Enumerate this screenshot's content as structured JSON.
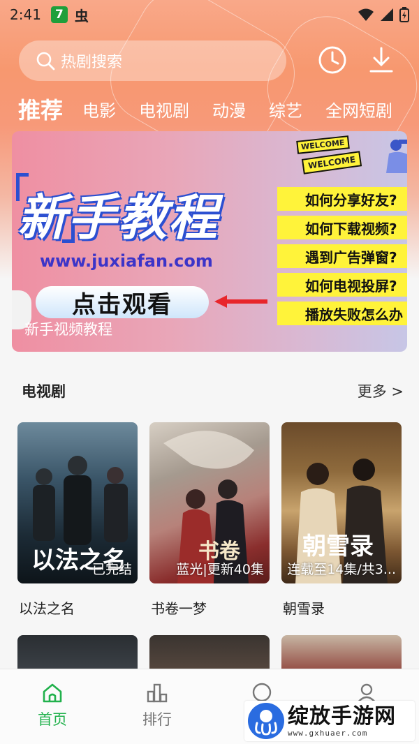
{
  "status_bar": {
    "time": "2:41",
    "app_badge": "7",
    "bug_glyph": "虫",
    "icons": [
      "wifi-icon",
      "signal-icon",
      "battery-icon"
    ]
  },
  "search": {
    "placeholder": "热剧搜索",
    "history_icon": "clock-icon",
    "download_icon": "download-icon"
  },
  "tabs": [
    {
      "label": "推荐",
      "active": true
    },
    {
      "label": "电影"
    },
    {
      "label": "电视剧"
    },
    {
      "label": "动漫"
    },
    {
      "label": "综艺"
    },
    {
      "label": "全网短剧"
    }
  ],
  "banner": {
    "title": "新手教程",
    "url": "www.juxiafan.com",
    "cta": "点击观看",
    "caption": "新手视频教程",
    "welcome_1": "WELCOME",
    "welcome_2": "WELCOME",
    "faq": [
      "如何分享好友?",
      "如何下载视频?",
      "遇到广告弹窗?",
      "如何电视投屏?",
      "播放失败怎么办"
    ]
  },
  "section": {
    "title": "电视剧",
    "more": "更多 >"
  },
  "shows": [
    {
      "name": "以法之名",
      "badge": "已完结",
      "poster_text": "以法之名"
    },
    {
      "name": "书卷一梦",
      "badge": "蓝光|更新40集",
      "poster_text": "书卷"
    },
    {
      "name": "朝雪录",
      "badge": "连载至14集/共3...",
      "poster_text": "朝雪录"
    }
  ],
  "nav": [
    {
      "label": "首页",
      "icon": "home-icon",
      "active": true
    },
    {
      "label": "排行",
      "icon": "ranking-icon"
    },
    {
      "label": "",
      "icon": "chat-icon"
    },
    {
      "label": "",
      "icon": "profile-icon"
    }
  ],
  "watermark": {
    "big": "绽放手游网",
    "small": "www.gxhuaer.com"
  },
  "colors": {
    "accent_green": "#21b14c",
    "header_orange": "#f7986f",
    "faq_yellow": "#fff33a"
  }
}
